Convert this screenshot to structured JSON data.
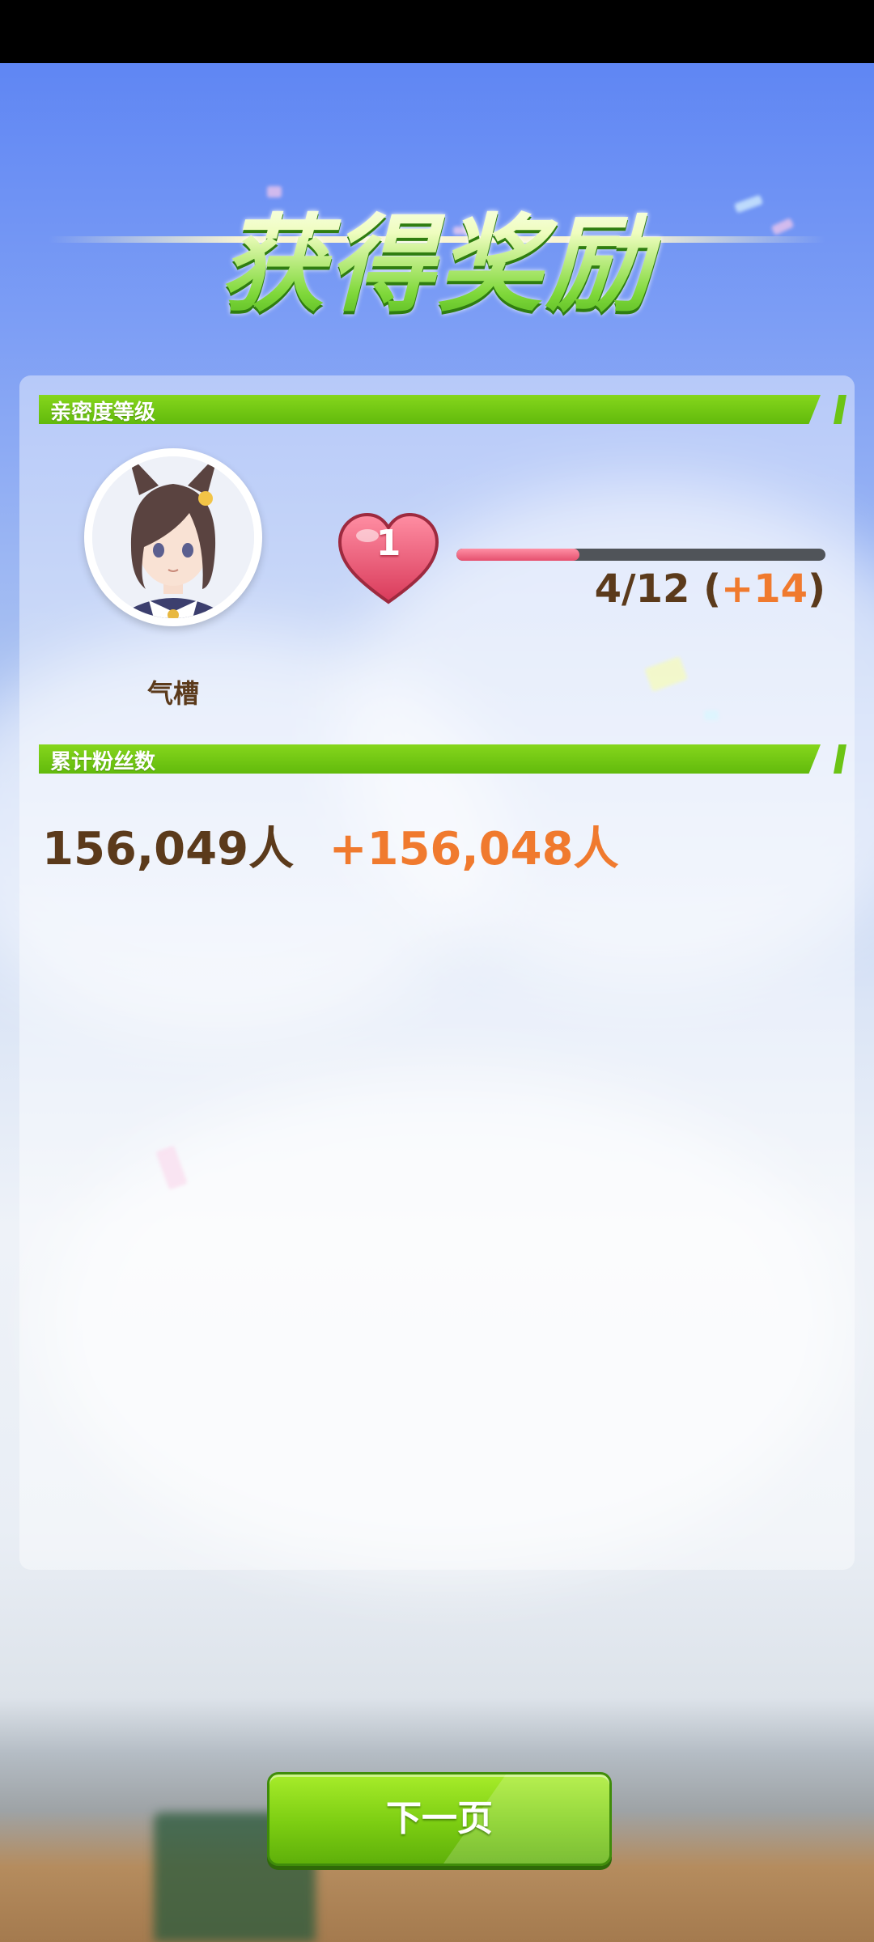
{
  "screen": {
    "title": "获得奖励"
  },
  "intimacy": {
    "section_label": "亲密度等级",
    "character_name": "气槽",
    "level": "1",
    "progress_fraction": 0.333,
    "progress_current": "4/12",
    "progress_gain": "+14",
    "colors": {
      "heart": "#e84a6a",
      "progress_fill": "#e5506e",
      "progress_track": "#505459"
    }
  },
  "fans": {
    "section_label": "累计粉丝数",
    "total": "156,049人",
    "gain": "+156,048人"
  },
  "footer": {
    "next_label": "下一页"
  },
  "colors": {
    "section_header": "#6cc414",
    "text_brown": "#5b3a1b",
    "text_orange": "#f07a2e",
    "button_green": "#7ccd12"
  },
  "icons": [
    "heart-icon",
    "character-portrait"
  ]
}
